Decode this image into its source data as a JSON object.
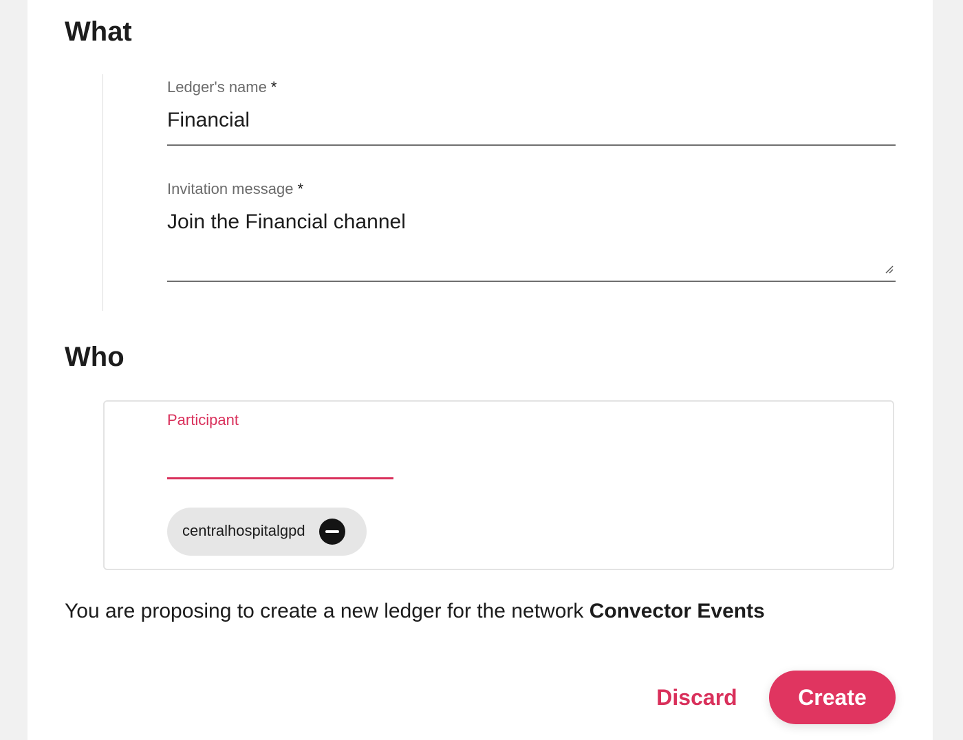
{
  "what": {
    "title": "What",
    "ledger_name": {
      "label": "Ledger's name",
      "required_mark": "*",
      "value": "Financial"
    },
    "invitation": {
      "label": "Invitation message",
      "required_mark": "*",
      "value": "Join the Financial channel"
    }
  },
  "who": {
    "title": "Who",
    "participant": {
      "label": "Participant",
      "value": ""
    },
    "chips": [
      {
        "label": "centralhospitalgpd",
        "remove_icon": "minus-circle-icon"
      }
    ]
  },
  "info": {
    "text": "You are proposing to create a new ledger for the network ",
    "network": "Convector Events"
  },
  "actions": {
    "discard_label": "Discard",
    "create_label": "Create"
  },
  "colors": {
    "accent": "#e03560",
    "accent_text": "#d9305b",
    "chip_bg": "#e6e6e6"
  }
}
